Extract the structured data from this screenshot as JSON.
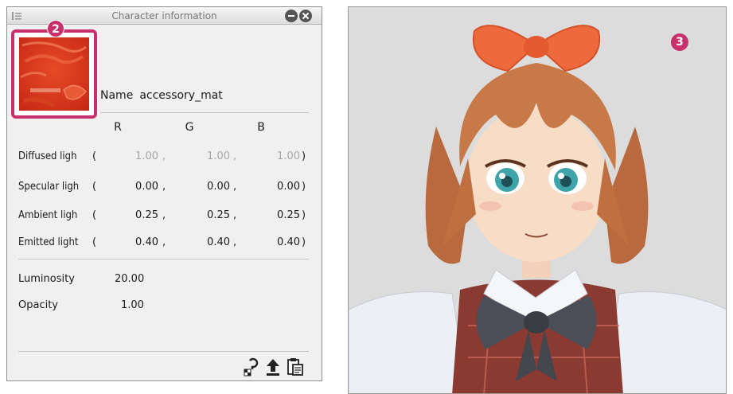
{
  "palette": {
    "title": "Character information",
    "callout_number": "2",
    "name_label": "Name",
    "name_value": "accessory_mat",
    "columns": [
      "R",
      "G",
      "B"
    ],
    "lights": [
      {
        "label": "Diffused ligh",
        "r": "1.00",
        "g": "1.00",
        "b": "1.00",
        "muted": true
      },
      {
        "label": "Specular ligh",
        "r": "0.00",
        "g": "0.00",
        "b": "0.00",
        "muted": false
      },
      {
        "label": "Ambient ligh",
        "r": "0.25",
        "g": "0.25",
        "b": "0.25",
        "muted": false
      },
      {
        "label": "Emitted light",
        "r": "0.40",
        "g": "0.40",
        "b": "0.40",
        "muted": false
      }
    ],
    "luminosity_label": "Luminosity",
    "luminosity_value": "20.00",
    "opacity_label": "Opacity",
    "opacity_value": "1.00"
  },
  "view": {
    "callout_number": "3"
  },
  "colors": {
    "callout": "#c8306b",
    "material_red": "#d83a1e",
    "background": "#dcdcdc"
  },
  "icons": [
    "panel-grip-icon",
    "minimize-icon",
    "close-icon",
    "material-swatch-icon",
    "export-icon",
    "paste-icon"
  ]
}
